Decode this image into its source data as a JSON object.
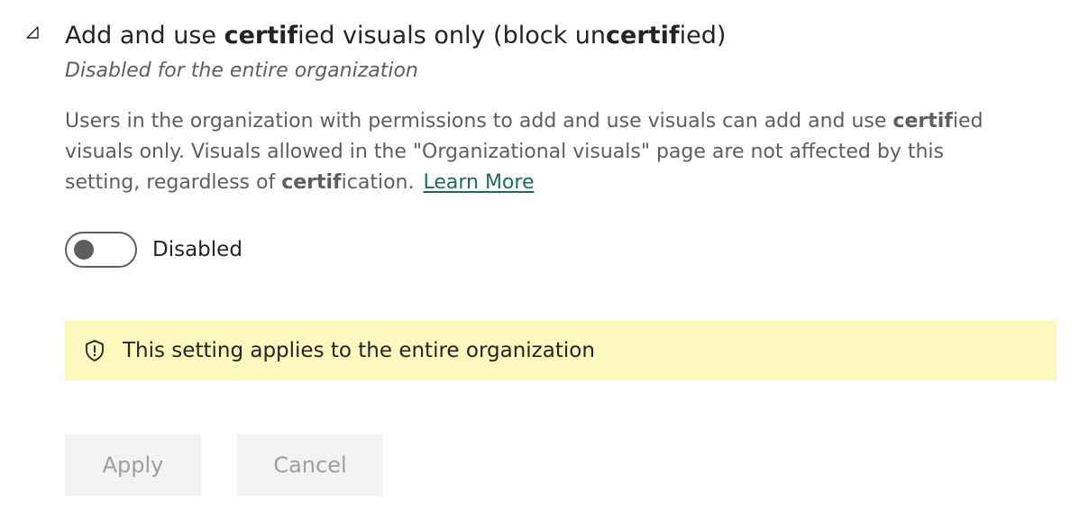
{
  "setting": {
    "title_parts": {
      "p1": "Add and use ",
      "b1": "certif",
      "p2": "ied visuals only (block un",
      "b2": "certif",
      "p3": "ied)"
    },
    "subtitle": "Disabled for the entire organization",
    "description_parts": {
      "p1": "Users in the organization with permissions to add and use visuals can add and use ",
      "b1": "certif",
      "p2": "ied visuals only. Visuals allowed in the \"Organizational visuals\" page are not affected by this setting, regardless of ",
      "b2": "certif",
      "p3": "ication."
    },
    "learn_more": "Learn More",
    "toggle": {
      "state": "off",
      "label": "Disabled"
    },
    "banner": {
      "icon": "shield-icon",
      "text": "This setting applies to the entire organization",
      "background": "#fdf8bd"
    },
    "buttons": {
      "apply": "Apply",
      "cancel": "Cancel"
    }
  },
  "colors": {
    "link": "#1e6b58",
    "muted_text": "#605e5c",
    "disabled_button_bg": "#f3f2f1",
    "disabled_button_text": "#a19f9d"
  }
}
